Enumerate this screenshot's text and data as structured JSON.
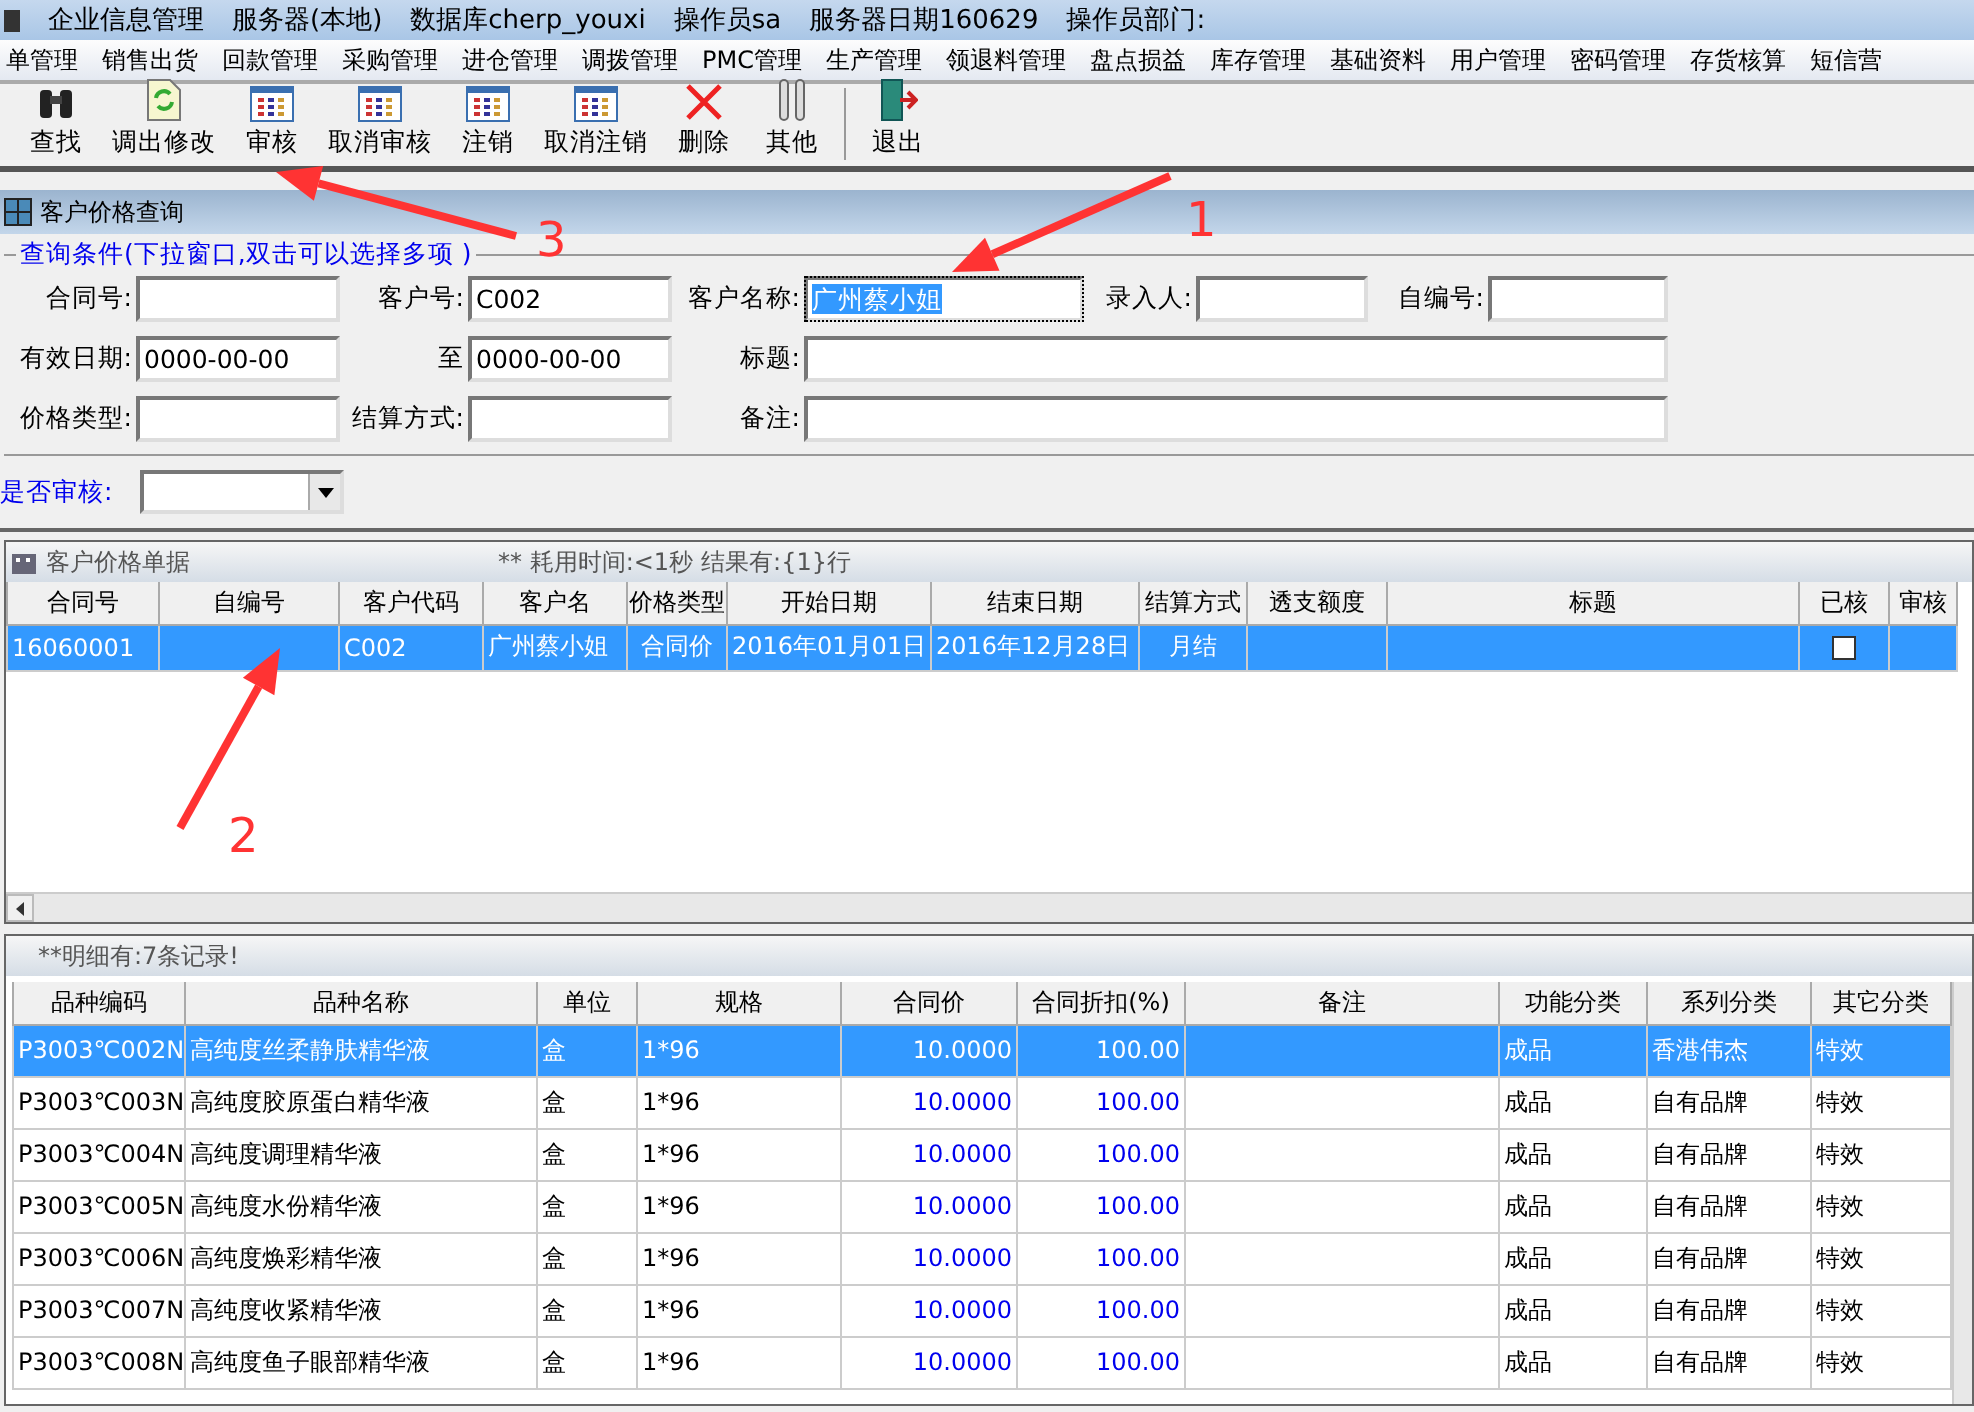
{
  "title_bar": {
    "app": "企业信息管理",
    "items": [
      "服务器(本地)",
      "数据库cherp_youxi",
      "操作员sa",
      "服务器日期160629",
      "操作员部门:"
    ]
  },
  "menu": [
    "单管理",
    "销售出货",
    "回款管理",
    "采购管理",
    "进仓管理",
    "调拨管理",
    "PMC管理",
    "生产管理",
    "领退料管理",
    "盘点损益",
    "库存管理",
    "基础资料",
    "用户管理",
    "密码管理",
    "存货核算",
    "短信营"
  ],
  "toolbar": [
    {
      "label": "查找",
      "kind": "binoculars"
    },
    {
      "label": "调出修改",
      "kind": "document"
    },
    {
      "label": "审核",
      "kind": "grid"
    },
    {
      "label": "取消审核",
      "kind": "grid"
    },
    {
      "label": "注销",
      "kind": "grid"
    },
    {
      "label": "取消注销",
      "kind": "grid"
    },
    {
      "label": "删除",
      "kind": "cross"
    },
    {
      "label": "其他",
      "kind": "other"
    },
    {
      "label": "退出",
      "kind": "exit"
    }
  ],
  "panel": {
    "title": "客户价格查询"
  },
  "query": {
    "legend": "查询条件(下拉窗口,双击可以选择多项 )",
    "fields": [
      {
        "label": "合同号:",
        "kind": "short",
        "focused": false
      },
      {
        "label": "客户号:",
        "value": "C002",
        "kind": "short",
        "focused": false
      },
      {
        "label": "客户名称:",
        "value": "广州蔡小姐",
        "kind": "short",
        "focused": true
      },
      {
        "label": "录入人:",
        "kind": "short",
        "focused": false
      },
      {
        "label": "自编号:",
        "kind": "short",
        "focused": false
      },
      {
        "label": "有效日期:",
        "value": "0000-00-00",
        "kind": "short",
        "focused": false
      },
      {
        "label": "至",
        "value": "0000-00-00",
        "kind": "short",
        "focused": false
      },
      {
        "label": "标题:",
        "kind": "wide",
        "focused": false
      },
      {
        "label": "价格类型:",
        "kind": "short",
        "focused": false
      },
      {
        "label": "结算方式:",
        "kind": "short",
        "focused": false
      },
      {
        "label": "备注:",
        "kind": "wide",
        "focused": false
      }
    ]
  },
  "audit_filter": {
    "label": "是否审核:"
  },
  "orders": {
    "title": "客户价格单据",
    "timing": "** 耗用时间:<1秒",
    "result": "结果有:{1}行",
    "columns": [
      {
        "label": "合同号",
        "kind": "text"
      },
      {
        "label": "自编号",
        "kind": "text"
      },
      {
        "label": "客户代码",
        "kind": "text"
      },
      {
        "label": "客户名",
        "kind": "text"
      },
      {
        "label": "价格类型",
        "kind": "center"
      },
      {
        "label": "开始日期",
        "kind": "text"
      },
      {
        "label": "结束日期",
        "kind": "text"
      },
      {
        "label": "结算方式",
        "kind": "center"
      },
      {
        "label": "透支额度",
        "kind": "text"
      },
      {
        "label": "标题",
        "kind": "text"
      },
      {
        "label": "已核",
        "kind": "check"
      },
      {
        "label": "审核",
        "kind": "text"
      }
    ],
    "rows": [
      {
        "selected": true,
        "checked": false,
        "cells": [
          "16060001",
          null,
          "C002",
          "广州蔡小姐",
          "合同价",
          "2016年01月01日",
          "2016年12月28日",
          "月结",
          null,
          null,
          null,
          null
        ]
      }
    ]
  },
  "details": {
    "title": "**明细有:7条记录!",
    "columns": [
      {
        "label": "品种编码",
        "kind": "text"
      },
      {
        "label": "品种名称",
        "kind": "text"
      },
      {
        "label": "单位",
        "kind": "text"
      },
      {
        "label": "规格",
        "kind": "text"
      },
      {
        "label": "合同价",
        "kind": "number"
      },
      {
        "label": "合同折扣(%)",
        "kind": "number"
      },
      {
        "label": "备注",
        "kind": "text"
      },
      {
        "label": "功能分类",
        "kind": "text"
      },
      {
        "label": "系列分类",
        "kind": "text"
      },
      {
        "label": "其它分类",
        "kind": "text"
      }
    ],
    "rows": [
      {
        "selected": true,
        "cells": [
          "P3003℃002N",
          "高纯度丝柔静肤精华液",
          "盒",
          "1*96",
          "10.0000",
          "100.00",
          null,
          "成品",
          "香港伟杰",
          "特效"
        ]
      },
      {
        "selected": false,
        "cells": [
          "P3003℃003N",
          "高纯度胶原蛋白精华液",
          "盒",
          "1*96",
          "10.0000",
          "100.00",
          null,
          "成品",
          "自有品牌",
          "特效"
        ]
      },
      {
        "selected": false,
        "cells": [
          "P3003℃004N",
          "高纯度调理精华液",
          "盒",
          "1*96",
          "10.0000",
          "100.00",
          null,
          "成品",
          "自有品牌",
          "特效"
        ]
      },
      {
        "selected": false,
        "cells": [
          "P3003℃005N",
          "高纯度水份精华液",
          "盒",
          "1*96",
          "10.0000",
          "100.00",
          null,
          "成品",
          "自有品牌",
          "特效"
        ]
      },
      {
        "selected": false,
        "cells": [
          "P3003℃006N",
          "高纯度焕彩精华液",
          "盒",
          "1*96",
          "10.0000",
          "100.00",
          null,
          "成品",
          "自有品牌",
          "特效"
        ]
      },
      {
        "selected": false,
        "cells": [
          "P3003℃007N",
          "高纯度收紧精华液",
          "盒",
          "1*96",
          "10.0000",
          "100.00",
          null,
          "成品",
          "自有品牌",
          "特效"
        ]
      },
      {
        "selected": false,
        "cells": [
          "P3003℃008N",
          "高纯度鱼子眼部精华液",
          "盒",
          "1*96",
          "10.0000",
          "100.00",
          null,
          "成品",
          "自有品牌",
          "特效"
        ]
      }
    ]
  },
  "annotations": [
    "1",
    "2",
    "3"
  ]
}
